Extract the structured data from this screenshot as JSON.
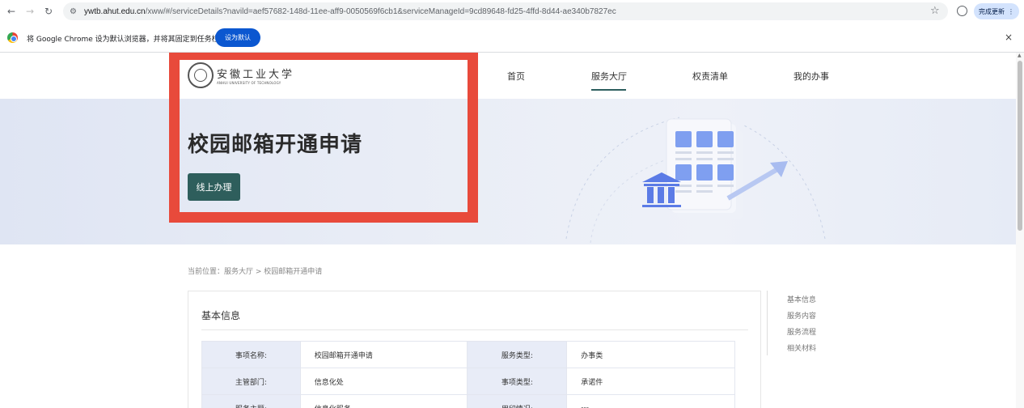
{
  "browser": {
    "url_host": "ywtb.ahut.edu.cn",
    "url_rest": "/xww/#/serviceDetails?navild=aef57682-148d-11ee-aff9-0050569f6cb1&serviceManageId=9cd89648-fd25-4ffd-8d44-ae340b7827ec",
    "update_label": "完成更新",
    "infobar_text": "将 Google Chrome 设为默认浏览器，并将其固定到任务栏",
    "set_default_label": "设为默认",
    "close_glyph": "×"
  },
  "site": {
    "logo_cn": "安徽工业大学",
    "logo_en": "ANHUI UNIVERSITY OF TECHNOLOGY",
    "nav": [
      "首页",
      "服务大厅",
      "权责清单",
      "我的办事"
    ],
    "active_nav": "服务大厅"
  },
  "banner": {
    "title": "校园邮箱开通申请",
    "button": "线上办理"
  },
  "breadcrumb": "当前位置：服务大厅 > 校园邮箱开通申请",
  "panel": {
    "title": "基本信息",
    "rows": [
      [
        {
          "k": "事项名称:",
          "v": "校园邮箱开通申请"
        },
        {
          "k": "服务类型:",
          "v": "办事类"
        }
      ],
      [
        {
          "k": "主管部门:",
          "v": "信息化处"
        },
        {
          "k": "事项类型:",
          "v": "承诺件"
        }
      ],
      [
        {
          "k": "服务主题:",
          "v": "信息化服务"
        },
        {
          "k": "用印情况:",
          "v": "---"
        }
      ]
    ]
  },
  "side_nav": [
    "基本信息",
    "服务内容",
    "服务流程",
    "相关材料"
  ],
  "colors": {
    "accent": "#2e5e5c",
    "highlight": "#e84a3b",
    "banner_bg": "#e6ebf6",
    "chrome_blue": "#0b57d0"
  }
}
